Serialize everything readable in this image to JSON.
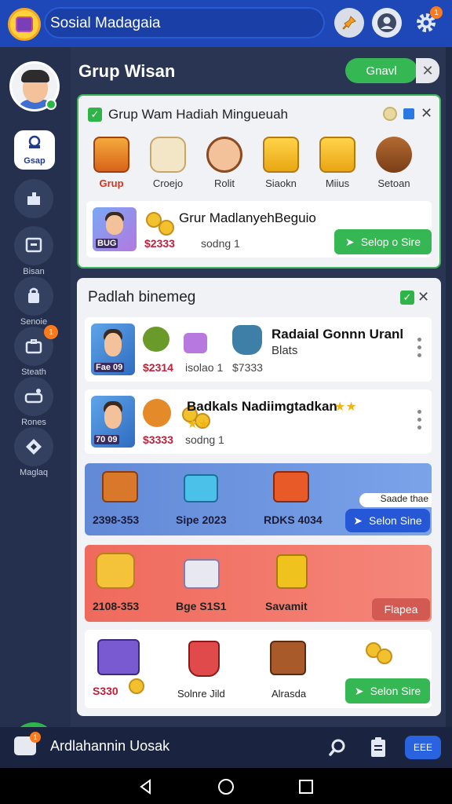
{
  "header": {
    "app_title": "Sosial Madagaia",
    "notification_count": "1"
  },
  "sidebar": {
    "items": [
      {
        "label": "Gsap",
        "icon": "tag-icon"
      },
      {
        "label": "",
        "icon": "puzzle-icon"
      },
      {
        "label": "Bisan",
        "icon": "store-icon"
      },
      {
        "label": "Senoie",
        "icon": "bag-icon"
      },
      {
        "label": "Steath",
        "icon": "briefcase-icon"
      },
      {
        "label": "Rones",
        "icon": "gamepad-icon"
      },
      {
        "label": "Maglaq",
        "icon": "diamond-icon"
      }
    ],
    "badge_count": "1"
  },
  "main": {
    "group_title": "Grup Wisan",
    "gnavl_label": "Gnavl",
    "close_label": "✕"
  },
  "card1": {
    "heading": "Grup  Wam Hadiah Mingueuah",
    "categories": [
      {
        "label": "Grup",
        "icon": "chest-icon"
      },
      {
        "label": "Croejo",
        "icon": "sack-icon"
      },
      {
        "label": "Rolit",
        "icon": "person-icon"
      },
      {
        "label": "Siaokn",
        "icon": "cheese-icon"
      },
      {
        "label": "Miius",
        "icon": "gift-box-icon"
      },
      {
        "label": "Setoan",
        "icon": "barrel-icon"
      }
    ],
    "banner": {
      "title": "Grur MadlanyehBeguio",
      "price": "$2333",
      "meta": "sodng 1",
      "badge": "BUG",
      "button": "Selop o Sire"
    }
  },
  "card2": {
    "heading": "Padlah binemeg",
    "items": [
      {
        "title": "Radaial Gonnn Uranl",
        "subtitle": "Blats",
        "badge": "Fae 09",
        "price": "$2314",
        "meta1": "isolao 1",
        "meta2": "$7333"
      },
      {
        "title": "Badkals Nadiimgtadkan",
        "badge": "70 09",
        "price": "$3333",
        "meta1": "sodng 1"
      }
    ],
    "promo_blue": {
      "labels": [
        "2398-353",
        "Sipe 2023",
        "RDKS 4034"
      ],
      "tag": "Saade thae",
      "button": "Selon Sine"
    },
    "promo_red": {
      "labels": [
        "2108-353",
        "Bge S1S1",
        "Savamit"
      ],
      "button": "Flapea"
    },
    "promo_white": {
      "labels": [
        "S330",
        "Solnre Jild",
        "Alrasda"
      ],
      "button": "Selon Sire"
    }
  },
  "bottombar": {
    "text": "Ardlahannin Uosak",
    "badge": "1",
    "keyboard_label": "EEE"
  },
  "colors": {
    "primary_blue": "#1e48b8",
    "accent_green": "#35b854",
    "price_red": "#c0203a"
  }
}
